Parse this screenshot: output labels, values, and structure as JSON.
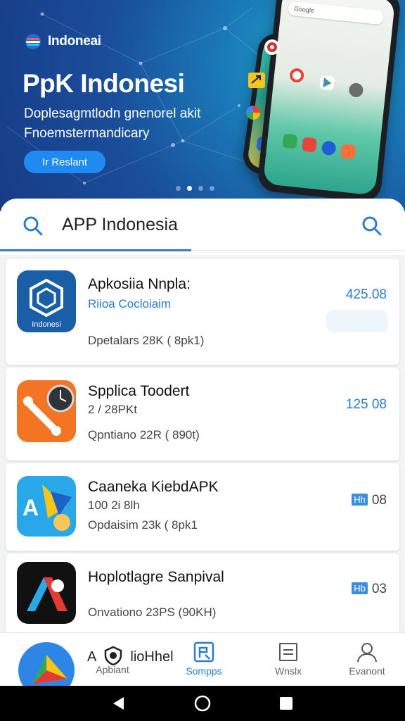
{
  "hero": {
    "brand": "Indoneai",
    "title": "PpK Indonesi",
    "subtitle": "Doplesagmtlodn gnenorel akit Fnoemstermandicary",
    "button": "Ir Reslant",
    "phone_search": "Google"
  },
  "search": {
    "query": "APP Indonesia"
  },
  "apps": [
    {
      "name": "Apkosiia Nnpla:",
      "sub": "Riioa Cocloiaim",
      "meta": "Dpetalars 28K ( 8pk1)",
      "price": "425.08",
      "icon": "app-cube-icon"
    },
    {
      "name": "Spplica Toodert",
      "sub": "2 / 28PKt",
      "meta": "Qpntiano 22R ( 890t)",
      "price": "125 08",
      "icon": "app-tools-icon"
    },
    {
      "name": "Caaneka KiebdAPK",
      "sub": "100 2i 8lh",
      "meta": "Opdaisim 23k ( 8pk1",
      "price_tag": "Hh",
      "price": "08",
      "icon": "app-letter-a-icon"
    },
    {
      "name": "Hoplotlagre Sanpival",
      "sub": "",
      "meta": "Onvationo 23PS (90KH)",
      "price_tag": "Hb",
      "price": "03",
      "icon": "app-red-a-icon"
    }
  ],
  "bottom_nav": {
    "overlay_text": "A",
    "overlay_brand": "lioHhel",
    "items": [
      {
        "label": "Apbiant",
        "icon": "home-icon",
        "active": false
      },
      {
        "label": "Sompps",
        "icon": "apps-icon",
        "active": true
      },
      {
        "label": "Wnslx",
        "icon": "list-icon",
        "active": false
      },
      {
        "label": "Evanont",
        "icon": "person-icon",
        "active": false
      }
    ]
  },
  "colors": {
    "accent": "#2a7bd4",
    "hero_dark": "#173c86",
    "hero_light": "#1fa4c4"
  }
}
